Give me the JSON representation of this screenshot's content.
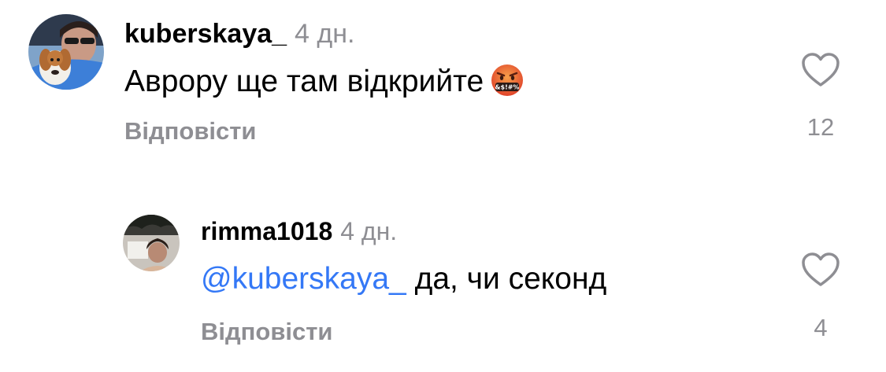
{
  "comments": [
    {
      "username": "kuberskaya_",
      "time": "4 дн.",
      "text": "Аврору ще там відкрийте",
      "emoji_icon": "face-with-symbols-on-mouth-icon",
      "reply_label": "Відповісти",
      "like_count": "12"
    },
    {
      "username": "rimma1018",
      "time": "4 дн.",
      "mention": "@kuberskaya_",
      "text": "да, чи секонд",
      "reply_label": "Відповісти",
      "like_count": "4"
    }
  ],
  "colors": {
    "text": "#000000",
    "secondary": "#8e8e93",
    "mention": "#3478f6",
    "emoji": "#e8532a"
  }
}
